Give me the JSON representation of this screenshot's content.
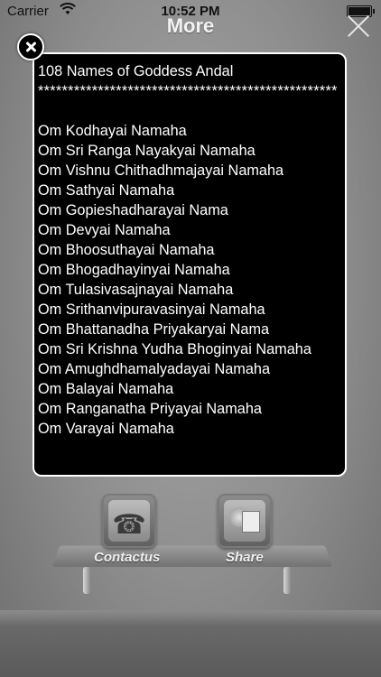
{
  "status_bar": {
    "carrier": "Carrier",
    "time": "10:52 PM"
  },
  "nav": {
    "title": "More"
  },
  "modal": {
    "lines": [
      "108 Names of Goddess Andal",
      "**************************************************",
      "",
      "Om Kodhayai Namaha",
      "Om Sri Ranga Nayakyai Namaha",
      "Om Vishnu Chithadhmajayai Namaha",
      "Om Sathyai Namaha",
      "Om Gopieshadharayai Nama",
      "Om Devyai Namaha",
      "Om Bhoosuthayai Namaha",
      "Om Bhogadhayinyai Namaha",
      "Om Tulasivasajnayai Namaha",
      "Om Srithanvipuravasinyai Namaha",
      "Om Bhattanadha Priyakaryai Nama",
      "Om Sri Krishna Yudha Bhoginyai Namaha",
      "Om Amughdhamalyadayai Namaha",
      "Om Balayai Namaha",
      "Om Ranganatha Priyayai Namaha",
      "Om Varayai Namaha"
    ]
  },
  "buttons": {
    "contact_label": "Contactus",
    "share_label": "Share"
  },
  "icons": {
    "modal_close": "close-icon",
    "nav_close": "close-icon",
    "contact": "phone-icon",
    "share": "share-icon",
    "wifi": "wifi-icon",
    "battery": "battery-icon"
  }
}
